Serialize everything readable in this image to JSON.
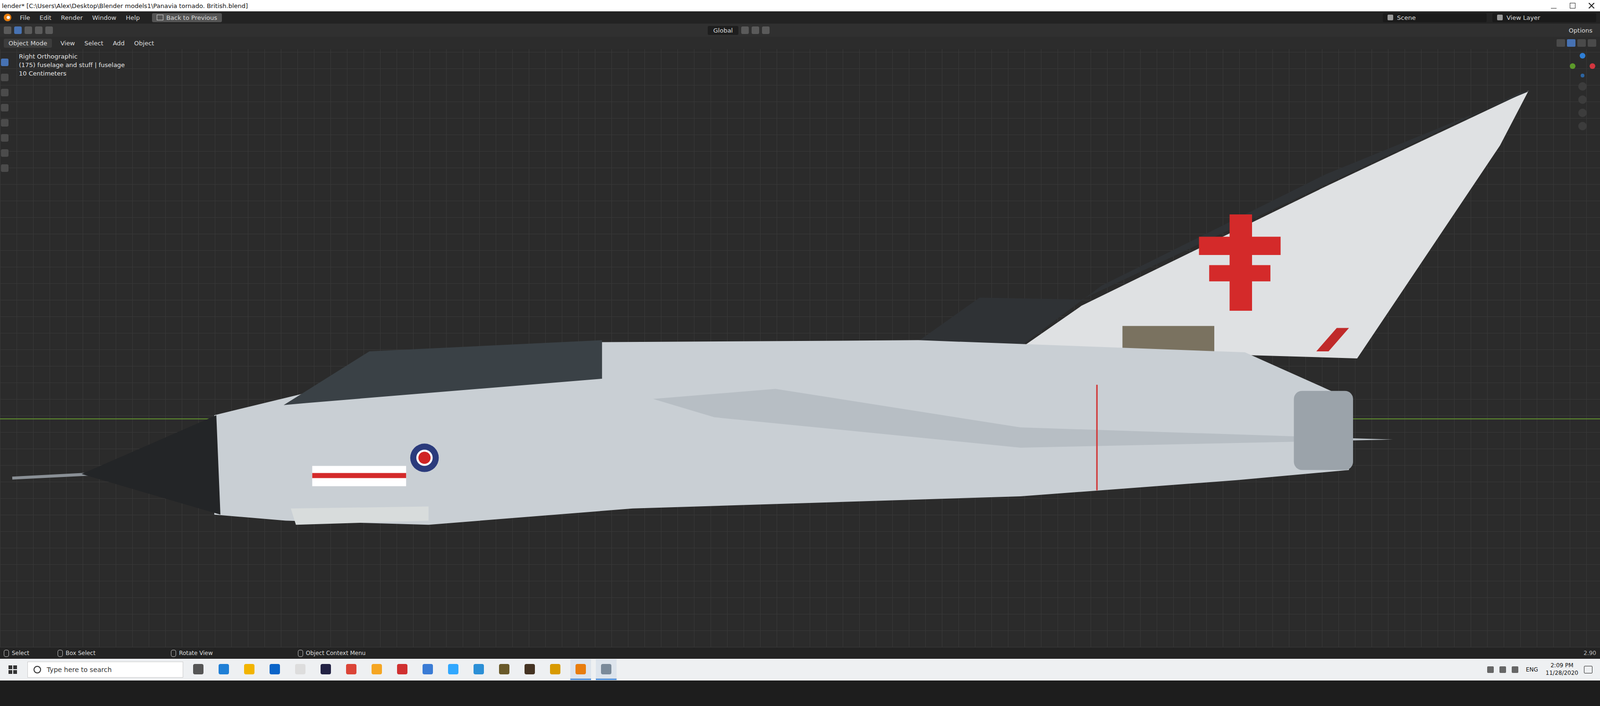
{
  "window": {
    "title": "lender* [C:\\Users\\Alex\\Desktop\\Blender models1\\Panavia tornado. British.blend]"
  },
  "menubar": {
    "items": [
      "File",
      "Edit",
      "Render",
      "Window",
      "Help"
    ],
    "back_button": "Back to Previous",
    "scene": "Scene",
    "view_layer": "View Layer"
  },
  "tool_settings": {
    "orientation": "Global",
    "options": "Options"
  },
  "viewport_header": {
    "mode": "Object Mode",
    "menus": [
      "View",
      "Select",
      "Add",
      "Object"
    ]
  },
  "viewport": {
    "view": "Right Orthographic",
    "object": "(175) fuselage and stuff | fuselage",
    "scale": "10 Centimeters"
  },
  "tools": [
    {
      "selected": true
    },
    {
      "selected": false
    },
    {
      "selected": false
    },
    {
      "selected": false
    },
    {
      "selected": false
    },
    {
      "selected": false
    },
    {
      "selected": false
    },
    {
      "selected": false
    }
  ],
  "status_bar": {
    "hints": [
      "Select",
      "Box Select",
      "Rotate View",
      "Object Context Menu"
    ],
    "version": "2.90"
  },
  "taskbar": {
    "search_placeholder": "Type here to search",
    "apps": [
      {
        "color": "#555555",
        "running": false
      },
      {
        "color": "#1f7fd6",
        "running": false
      },
      {
        "color": "#f2b400",
        "running": false
      },
      {
        "color": "#0a64c8",
        "running": false
      },
      {
        "color": "#dddddd",
        "running": false
      },
      {
        "color": "#222244",
        "running": false
      },
      {
        "color": "#db4437",
        "running": false
      },
      {
        "color": "#f5a623",
        "running": false
      },
      {
        "color": "#d03030",
        "running": false
      },
      {
        "color": "#3a7bd5",
        "running": false
      },
      {
        "color": "#31a8ff",
        "running": false
      },
      {
        "color": "#2b8fd6",
        "running": false
      },
      {
        "color": "#6a5a2a",
        "running": false
      },
      {
        "color": "#443322",
        "running": false
      },
      {
        "color": "#d89a00",
        "running": false
      },
      {
        "color": "#e87d0d",
        "running": true
      },
      {
        "color": "#7a8a9a",
        "running": true
      }
    ],
    "language": "ENG",
    "time": "2:09 PM",
    "date": "11/28/2020"
  }
}
